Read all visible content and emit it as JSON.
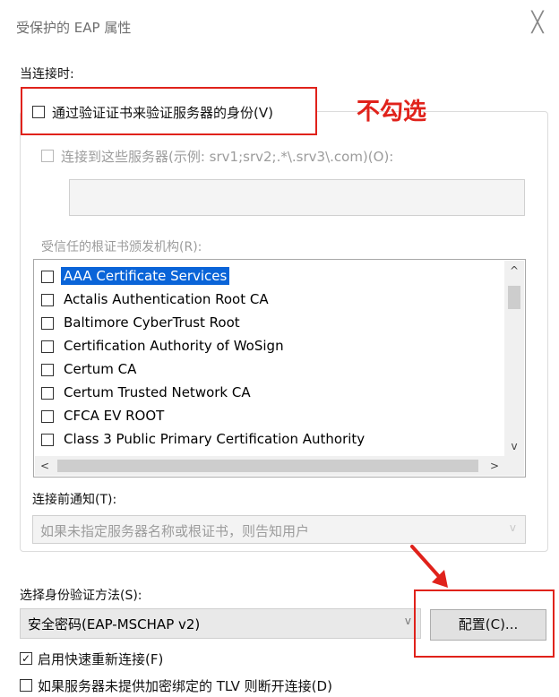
{
  "window": {
    "title": "受保护的 EAP 属性",
    "close_glyph": "╳"
  },
  "when_connecting": {
    "label": "当连接时:",
    "verify_cert_label": "通过验证证书来验证服务器的身份(V)",
    "verify_cert_checked": false,
    "connect_servers_label": "连接到这些服务器(示例: srv1;srv2;.*\\.srv3\\.com)(O):",
    "servers_value": "",
    "trusted_ca_label": "受信任的根证书颁发机构(R):",
    "trusted_ca_list": [
      {
        "name": "AAA Certificate Services",
        "selected": true
      },
      {
        "name": "Actalis Authentication Root CA",
        "selected": false
      },
      {
        "name": "Baltimore CyberTrust Root",
        "selected": false
      },
      {
        "name": "Certification Authority of WoSign",
        "selected": false
      },
      {
        "name": "Certum CA",
        "selected": false
      },
      {
        "name": "Certum Trusted Network CA",
        "selected": false
      },
      {
        "name": "CFCA EV ROOT",
        "selected": false
      },
      {
        "name": "Class 3 Public Primary Certification Authority",
        "selected": false
      }
    ],
    "notify_label": "连接前通知(T):",
    "notify_value": "如果未指定服务器名称或根证书，则告知用户"
  },
  "auth": {
    "method_label": "选择身份验证方法(S):",
    "method_value": "安全密码(EAP-MSCHAP v2)",
    "configure_button": "配置(C)...",
    "fast_reconnect_label": "启用快速重新连接(F)",
    "fast_reconnect_checked": true,
    "tlv_label": "如果服务器未提供加密绑定的 TLV 则断开连接(D)",
    "tlv_checked": false
  },
  "annotation": {
    "text": "不勾选",
    "color": "#e0221b"
  },
  "scroll_glyphs": {
    "up": "^",
    "down": "v",
    "left": "<",
    "right": ">",
    "combo_arrow": "v"
  }
}
